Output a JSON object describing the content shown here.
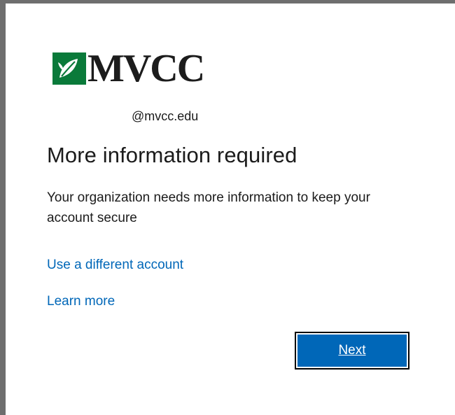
{
  "logo": {
    "text": "MVCC",
    "mark_icon": "leaf-logo-icon",
    "brand_color": "#0a7a3a"
  },
  "identity": {
    "account": "@mvcc.edu"
  },
  "content": {
    "title": "More information required",
    "description": "Your organization needs more information to keep your account secure"
  },
  "links": {
    "different_account": "Use a different account",
    "learn_more": "Learn more"
  },
  "buttons": {
    "next_label": "Next"
  },
  "colors": {
    "link": "#0067b8",
    "button_bg": "#0067b8",
    "text": "#1b1b1b"
  }
}
